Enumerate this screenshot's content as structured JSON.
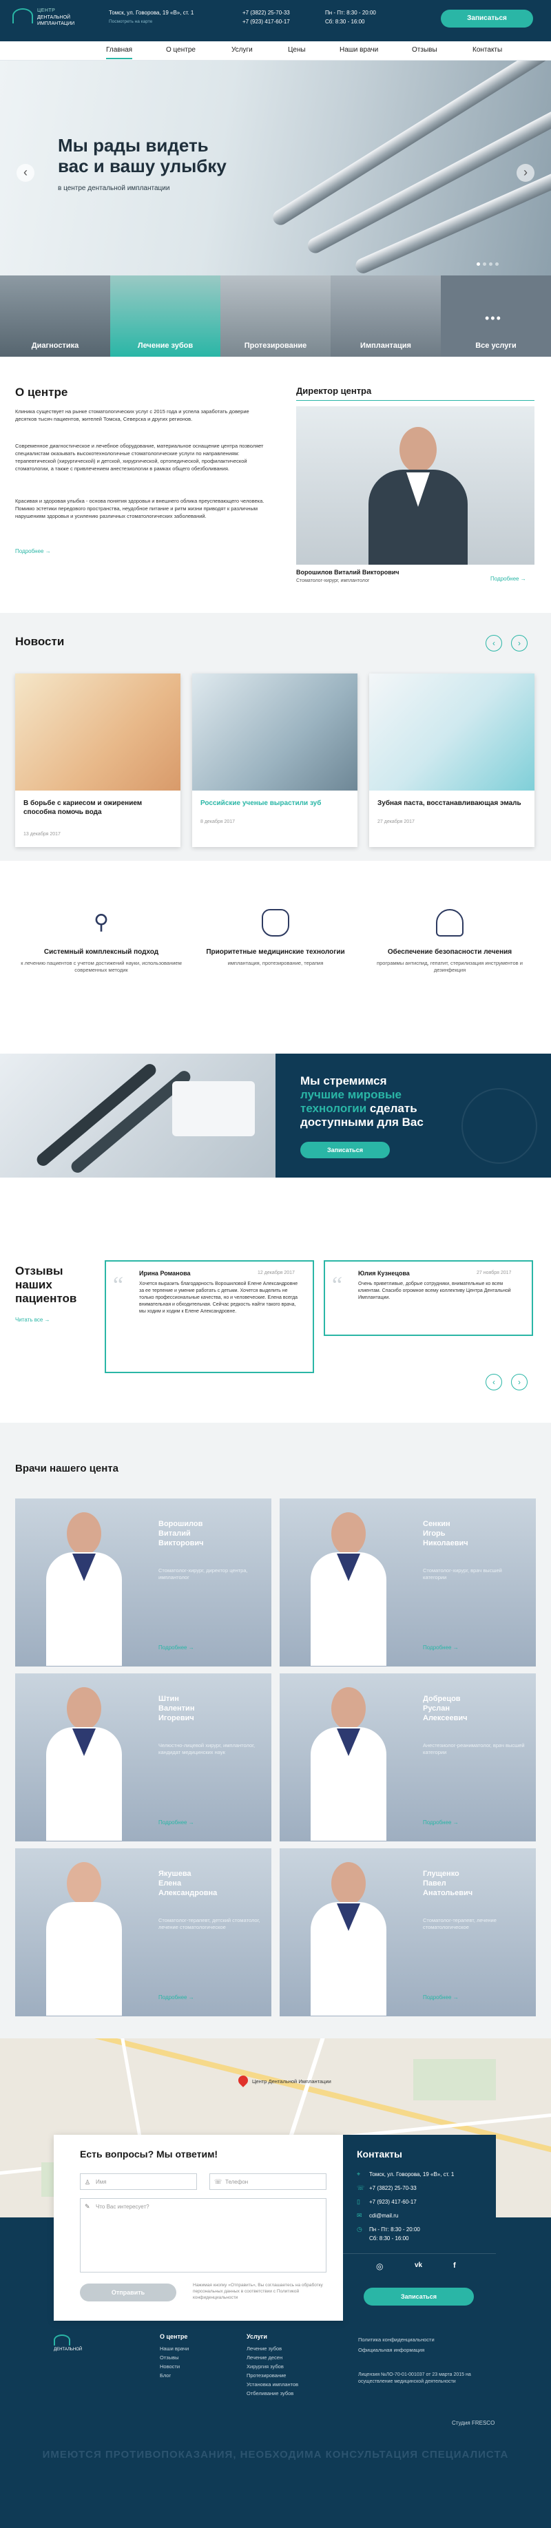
{
  "header": {
    "logo_line1": "ЦЕНТР",
    "logo_line2": "ДЕНТАЛЬНОЙ",
    "logo_line3": "ИМПЛАНТАЦИИ",
    "address": "Томск, ул. Говорова, 19 «В», ст. 1",
    "address_sub": "Посмотреть на карте",
    "phone1": "+7 (3822) 25-70-33",
    "phone2": "+7 (923) 417-60-17",
    "hours1": "Пн - Пт: 8:30 - 20:00",
    "hours2": "Сб: 8:30 - 16:00",
    "cta": "Записаться"
  },
  "nav": [
    "Главная",
    "О центре",
    "Услуги",
    "Цены",
    "Наши врачи",
    "Отзывы",
    "Контакты"
  ],
  "hero": {
    "title1": "Мы рады видеть",
    "title2": "вас и вашу улыбку",
    "subtitle": "в центре дентальной имплантации",
    "prev": "‹",
    "next": "›"
  },
  "services": [
    "Диагностика",
    "Лечение зубов",
    "Протезирование",
    "Имплантация",
    "Все услуги"
  ],
  "about": {
    "title": "О центре",
    "p1": "Клиника существует на рынке стоматологических услуг с 2015 года и успела заработать доверие десятков тысяч пациентов, жителей Томска, Северска и других регионов.",
    "p2": "Современное диагностическое и лечебное оборудование, материальное оснащение центра позволяет специалистам оказывать высокотехнологичные стоматологические услуги по направлениям: терапевтической (хирургической) и детской, хирургической, ортопедической, профилактической стоматологии, а также с привлечением анестезиологии в рамках общего обезболивания.",
    "p3": "Красивая и здоровая улыбка - основа понятия здоровья и внешнего облика преуспевающего человека. Помимо эстетики передового пространства, неудобное питание и ритм жизни приводят к различным нарушениям здоровья и усилению различных стоматологических заболеваний.",
    "more": "Подробнее →"
  },
  "director": {
    "title": "Директор центра",
    "name": "Ворошилов Виталий Викторович",
    "role": "Стоматолог-хирург, имплантолог",
    "more": "Подробнее →"
  },
  "news": {
    "title": "Новости",
    "items": [
      {
        "title": "В борьбе с кариесом и ожирением способна помочь вода",
        "date": "13 декабря 2017"
      },
      {
        "title": "Российские ученые вырастили зуб",
        "date": "8 декабря 2017"
      },
      {
        "title": "Зубная паста, восстанавливающая эмаль",
        "date": "27 декабря 2017"
      }
    ]
  },
  "features": [
    {
      "title": "Системный комплексный подход",
      "text": "к лечению пациентов с учетом достижений науки, использованием современных методик"
    },
    {
      "title": "Приоритетные медицинские технологии",
      "text": "имплантация, протезирование, терапия"
    },
    {
      "title": "Обеспечение безопасности лечения",
      "text": "программы антиспид, гепатит, стерилизация инструментов и дезинфекция"
    }
  ],
  "mission": {
    "line1": "Мы стремимся",
    "line2": "лучшие мировые",
    "line3": "технологии",
    "line3b": "сделать",
    "line4": "доступными для Вас",
    "cta": "Записаться"
  },
  "reviews": {
    "title1": "Отзывы",
    "title2": "наших",
    "title3": "пациентов",
    "all": "Читать все →",
    "items": [
      {
        "name": "Ирина Романова",
        "date": "12 декабря 2017",
        "text": "Хочется выразить благодарность Ворошиловой Елене Александровне за ее терпение и умение работать с детьми. Хочется выделить не только профессиональные качества, но и человеческие. Елена всегда внимательная и обходительная. Сейчас редкость найти такого врача, мы ходим и ходим к Елене Александровне."
      },
      {
        "name": "Юлия Кузнецова",
        "date": "27 ноября 2017",
        "text": "Очень приветливые, добрые сотрудники, внимательные ко всем клиентам. Спасибо огромное всему коллективу Центра Дентальной Имплантации."
      }
    ]
  },
  "doctors": {
    "title": "Врачи нашего цента",
    "more": "Подробнее →",
    "items": [
      {
        "name1": "Ворошилов",
        "name2": "Виталий",
        "name3": "Викторович",
        "desc": "Стоматолог-хирург, директор центра, имплантолог"
      },
      {
        "name1": "Сенкин",
        "name2": "Игорь",
        "name3": "Николаевич",
        "desc": "Стоматолог-хирург, врач высшей категории"
      },
      {
        "name1": "Штин",
        "name2": "Валентин",
        "name3": "Игоревич",
        "desc": "Челюстно-лицевой хирург, имплантолог, кандидат медицинских наук"
      },
      {
        "name1": "Добрецов",
        "name2": "Руслан",
        "name3": "Алексеевич",
        "desc": "Анестезиолог-реаниматолог, врач высшей категории"
      },
      {
        "name1": "Якушева",
        "name2": "Елена",
        "name3": "Александровна",
        "desc": "Стоматолог-терапевт, детский стоматолог, лечение стоматологическое"
      },
      {
        "name1": "Глущенко",
        "name2": "Павел",
        "name3": "Анатольевич",
        "desc": "Стоматолог-терапевт, лечение стоматологическое"
      }
    ]
  },
  "map": {
    "marker": "Центр Дентальной Имплантации"
  },
  "form": {
    "title": "Есть вопросы? Мы ответим!",
    "name_ph": "Имя",
    "phone_ph": "Телефон",
    "msg_ph": "Что Вас интересует?",
    "submit": "Отправить",
    "note": "Нажимая кнопку «Отправить», Вы соглашаетесь на обработку персональных данных в соответствии с Политикой конфиденциальности"
  },
  "contacts": {
    "title": "Контакты",
    "address": "Томск, ул. Говорова, 19 «В», ст. 1",
    "phone1": "+7 (3822) 25-70-33",
    "phone2": "+7 (923) 417-60-17",
    "email": "cdi@mail.ru",
    "hours1": "Пн - Пт:  8:30 - 20:00",
    "hours2": "Сб:  8:30 - 16:00",
    "cta": "Записаться"
  },
  "footer": {
    "col1_title": "О центре",
    "col1": [
      "Наши врачи",
      "Отзывы",
      "Новости",
      "Блог"
    ],
    "col2_title": "Услуги",
    "col2": [
      "Лечение зубов",
      "Лечение десен",
      "Хирургия зубов",
      "Протезирование",
      "Установка имплантов",
      "Отбеливание зубов"
    ],
    "col3": [
      "Политика конфиденциальности",
      "Официальная информация"
    ],
    "license": "Лицензия №ЛО-70-01-001037 от 23 марта 2015 на осуществление медицинской деятельности",
    "studio": "Студия FRESCO",
    "disclaimer": "ИМЕЮТСЯ ПРОТИВОПОКАЗАНИЯ, НЕОБХОДИМА КОНСУЛЬТАЦИЯ СПЕЦИАЛИСТА"
  }
}
